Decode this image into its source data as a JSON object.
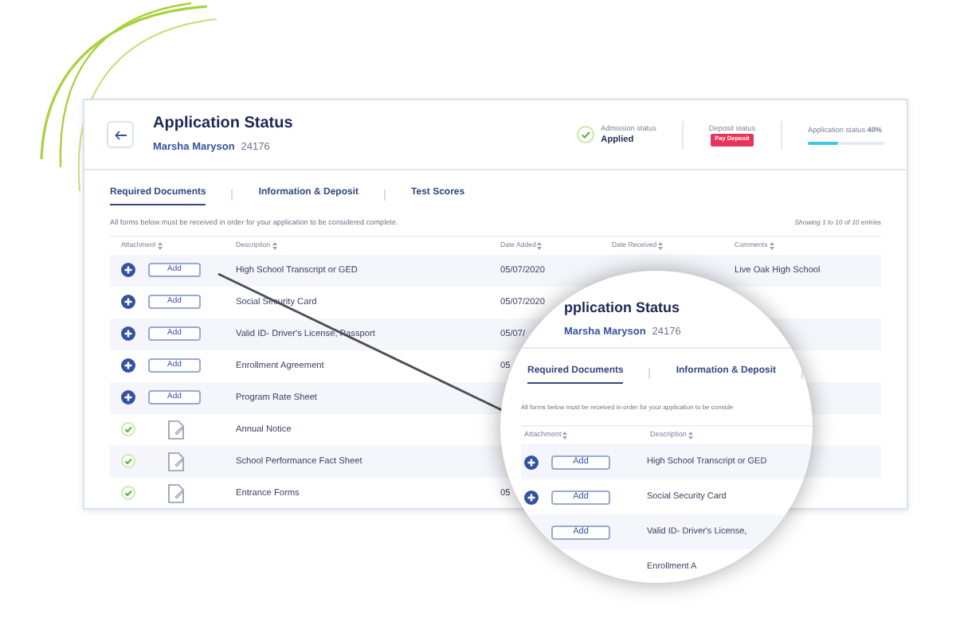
{
  "header": {
    "title": "Application Status",
    "name": "Marsha Maryson",
    "id": "24176",
    "admission": {
      "label": "Admission status",
      "value": "Applied"
    },
    "deposit": {
      "label": "Deposit status",
      "badge": "Pay Deposit"
    },
    "progress": {
      "label": "Application status",
      "percent": "40%",
      "level": 0.4
    }
  },
  "tabs": [
    {
      "label": "Required Documents",
      "selected": true
    },
    {
      "label": "Information & Deposit",
      "selected": false
    },
    {
      "label": "Test Scores",
      "selected": false
    }
  ],
  "note": "All forms below must be received in order for your application to be considered complete.",
  "entries": "Showing 1 to 10 of 10 entries",
  "table": {
    "columns": [
      "Attachment",
      "Description",
      "Date Added",
      "Date Received",
      "Comments"
    ],
    "rows": [
      {
        "kind": "add",
        "button": "Add",
        "description": "High School Transcript or GED",
        "date_added": "05/07/2020",
        "comments": "Live Oak High School"
      },
      {
        "kind": "add",
        "button": "Add",
        "description": "Social Security Card",
        "date_added": "05/07/2020"
      },
      {
        "kind": "add",
        "button": "Add",
        "description": "Valid ID- Driver's License, Passport",
        "date_added": "05/07/"
      },
      {
        "kind": "add",
        "button": "Add",
        "description": "Enrollment Agreement",
        "date_added": "05"
      },
      {
        "kind": "add",
        "button": "Add",
        "description": "Program Rate Sheet"
      },
      {
        "kind": "done",
        "description": "Annual Notice"
      },
      {
        "kind": "done",
        "description": "School Performance Fact Sheet"
      },
      {
        "kind": "done",
        "description": "Entrance Forms",
        "date_added": "05"
      }
    ]
  },
  "magnifier": {
    "title": "pplication Status",
    "name": "Marsha Maryson",
    "id": "24176",
    "tabs": [
      {
        "label": "Required Documents",
        "selected": true
      },
      {
        "label": "Information & Deposit",
        "selected": false
      }
    ],
    "note": "All forms below must be received in order for your application to be conside",
    "columns": [
      "Attachment",
      "Description"
    ],
    "rows": [
      {
        "plus": true,
        "button": "Add",
        "description": "High School Transcript or GED"
      },
      {
        "plus": true,
        "button": "Add",
        "description": "Social Security Card"
      },
      {
        "plus": false,
        "button": "Add",
        "description": "Valid ID- Driver's License,"
      },
      {
        "description": "Enrollment A"
      }
    ]
  }
}
